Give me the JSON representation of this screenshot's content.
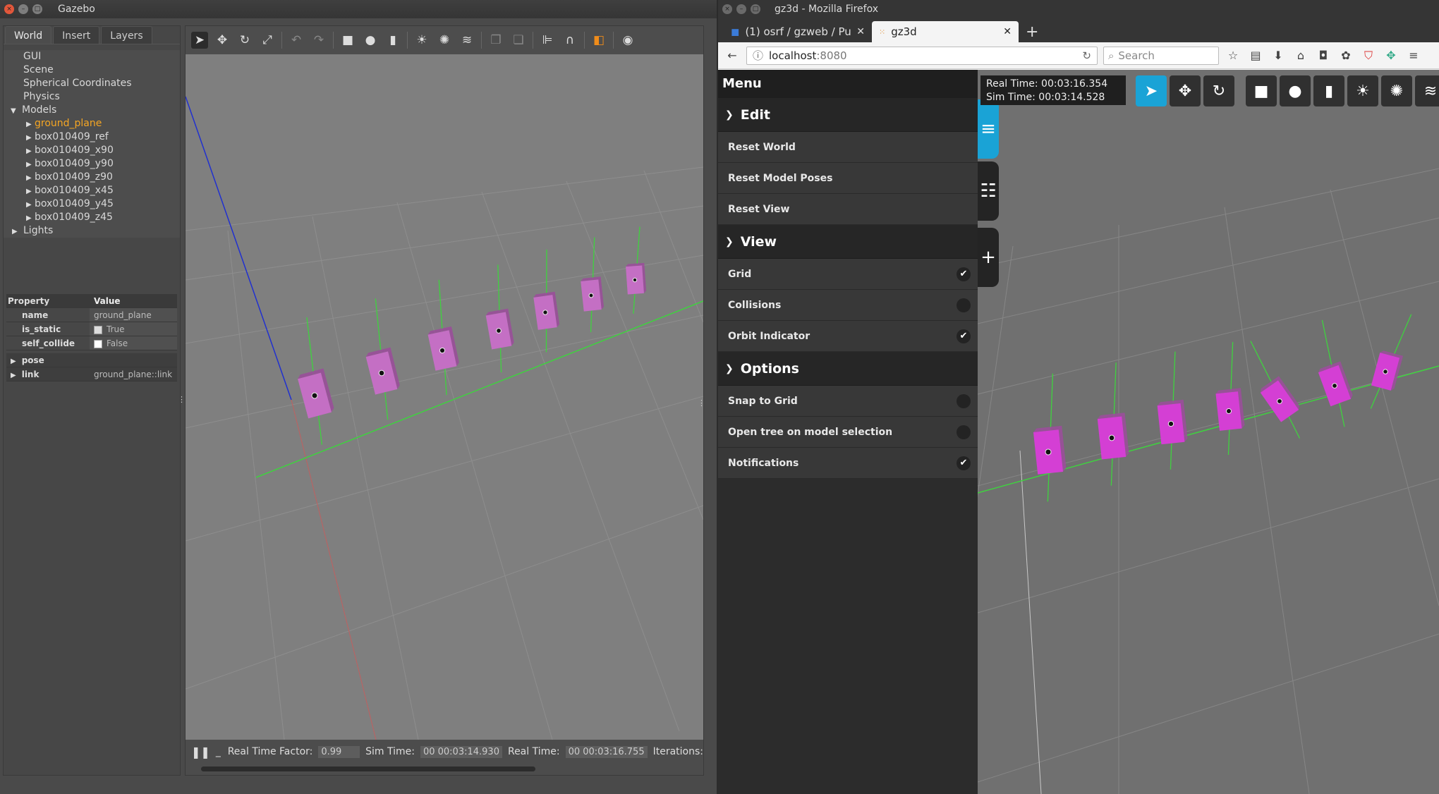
{
  "gazebo": {
    "title": "Gazebo",
    "tabs": [
      "World",
      "Insert",
      "Layers"
    ],
    "tree": {
      "items": [
        "GUI",
        "Scene",
        "Spherical Coordinates",
        "Physics"
      ],
      "models_label": "Models",
      "models": [
        "ground_plane",
        "box010409_ref",
        "box010409_x90",
        "box010409_y90",
        "box010409_z90",
        "box010409_x45",
        "box010409_y45",
        "box010409_z45"
      ],
      "lights_label": "Lights"
    },
    "properties": {
      "header_property": "Property",
      "header_value": "Value",
      "rows": [
        {
          "key": "name",
          "value": "ground_plane"
        },
        {
          "key": "is_static",
          "value": "True"
        },
        {
          "key": "self_collide",
          "value": "False"
        },
        {
          "key": "pose",
          "value": ""
        },
        {
          "key": "link",
          "value": "ground_plane::link"
        }
      ]
    },
    "status": {
      "rtf_label": "Real Time Factor:",
      "rtf_value": "0.99",
      "sim_label": "Sim Time:",
      "sim_value": "00 00:03:14.930",
      "real_label": "Real Time:",
      "real_value": "00 00:03:16.755",
      "iter_label": "Iterations:"
    }
  },
  "firefox": {
    "title": "gz3d - Mozilla Firefox",
    "tabs": [
      {
        "label": "(1) osrf / gzweb / Pu"
      },
      {
        "label": "gz3d"
      }
    ],
    "url_host": "localhost",
    "url_port": ":8080",
    "search_placeholder": "Search"
  },
  "gz3d": {
    "menu_title": "Menu",
    "sections": [
      {
        "title": "Edit",
        "items": [
          {
            "label": "Reset World"
          },
          {
            "label": "Reset Model Poses"
          },
          {
            "label": "Reset View"
          }
        ]
      },
      {
        "title": "View",
        "items": [
          {
            "label": "Grid",
            "checked": true
          },
          {
            "label": "Collisions",
            "checked": false
          },
          {
            "label": "Orbit Indicator",
            "checked": true
          }
        ]
      },
      {
        "title": "Options",
        "items": [
          {
            "label": "Snap to Grid",
            "checked": false
          },
          {
            "label": "Open tree on model selection",
            "checked": false
          },
          {
            "label": "Notifications",
            "checked": true
          }
        ]
      }
    ],
    "real_time": "Real Time: 00:03:16.354",
    "sim_time": "Sim Time: 00:03:14.528"
  },
  "colors": {
    "accent": "#1aa3d6",
    "model_selected": "#f5a623",
    "box": "#c46fc4",
    "box_web": "#d43fd4"
  }
}
